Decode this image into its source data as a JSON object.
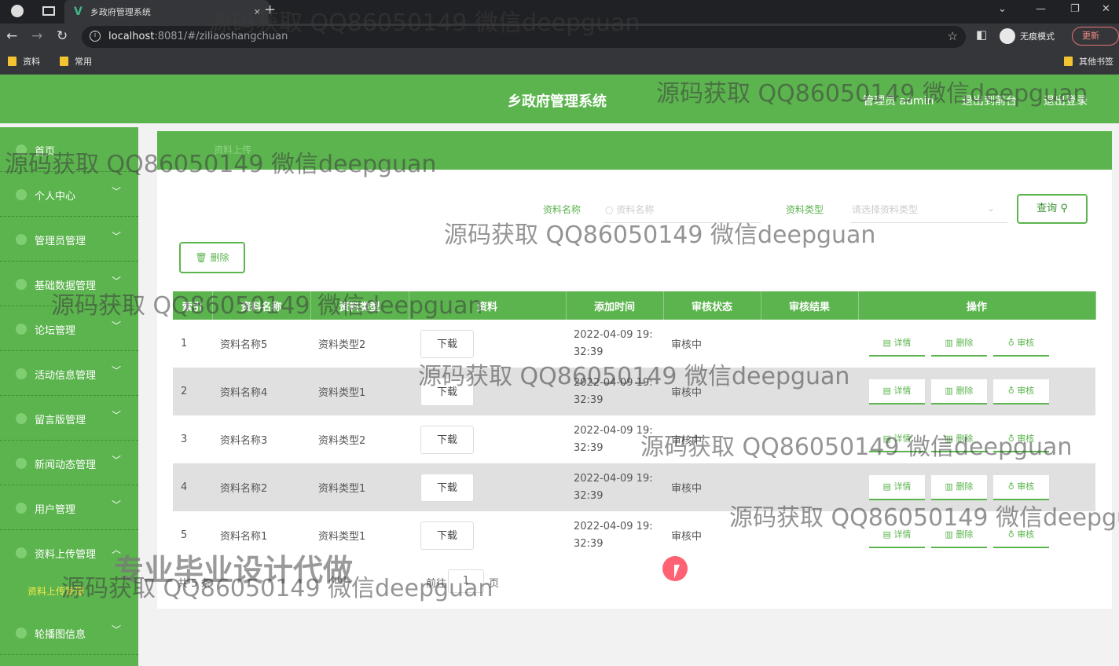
{
  "browser": {
    "tab_title": "乡政府管理系统",
    "url_host": "localhost",
    "url_rest": ":8081/#/ziliaoshangchuan",
    "incognito_label": "无痕模式",
    "update_label": "更新",
    "bookmarks": [
      "资料",
      "常用"
    ],
    "other_bookmarks": "其他书签"
  },
  "header": {
    "title": "乡政府管理系统",
    "user": "管理员 admin",
    "back_front": "退出到前台",
    "logout": "退出登录"
  },
  "sidebar": {
    "items": [
      "首页",
      "个人中心",
      "管理员管理",
      "基础数据管理",
      "论坛管理",
      "活动信息管理",
      "留言版管理",
      "新闻动态管理",
      "用户管理",
      "资料上传管理",
      "轮播图信息"
    ],
    "sub_active": "资料上传管理"
  },
  "breadcrumb": "资料上传",
  "search": {
    "name_label": "资料名称",
    "name_placeholder": "资料名称",
    "type_label": "资料类型",
    "type_placeholder": "请选择资料类型",
    "query_button": "查询"
  },
  "toolbar": {
    "delete_button": "删除"
  },
  "table": {
    "headers": [
      "索引",
      "资料名称",
      "资料类型",
      "资料",
      "添加时间",
      "审核状态",
      "审核结果",
      "操作"
    ],
    "rows": [
      {
        "index": "1",
        "name": "资料名称5",
        "type": "资料类型2",
        "download": "下载",
        "date": "2022-04-09 19:",
        "time": "32:39",
        "status": "审核中"
      },
      {
        "index": "2",
        "name": "资料名称4",
        "type": "资料类型1",
        "download": "下载",
        "date": "2022-04-09 19:",
        "time": "32:39",
        "status": "审核中"
      },
      {
        "index": "3",
        "name": "资料名称3",
        "type": "资料类型2",
        "download": "下载",
        "date": "2022-04-09 19:",
        "time": "32:39",
        "status": "审核中"
      },
      {
        "index": "4",
        "name": "资料名称2",
        "type": "资料类型1",
        "download": "下载",
        "date": "2022-04-09 19:",
        "time": "32:39",
        "status": "审核中"
      },
      {
        "index": "5",
        "name": "资料名称1",
        "type": "资料类型1",
        "download": "下载",
        "date": "2022-04-09 19:",
        "time": "32:39",
        "status": "审核中"
      }
    ],
    "op_detail": "详情",
    "op_delete": "删除",
    "op_review": "审核"
  },
  "pager": {
    "total": "共 5 条",
    "goto": "前往",
    "page": "1",
    "suffix": "页"
  },
  "watermark": "源码获取 QQ86050149 微信deepguan",
  "promo": "专业毕业设计代做",
  "colors": {
    "primary": "#5cb44e",
    "sub_active": "#f7e84a"
  }
}
